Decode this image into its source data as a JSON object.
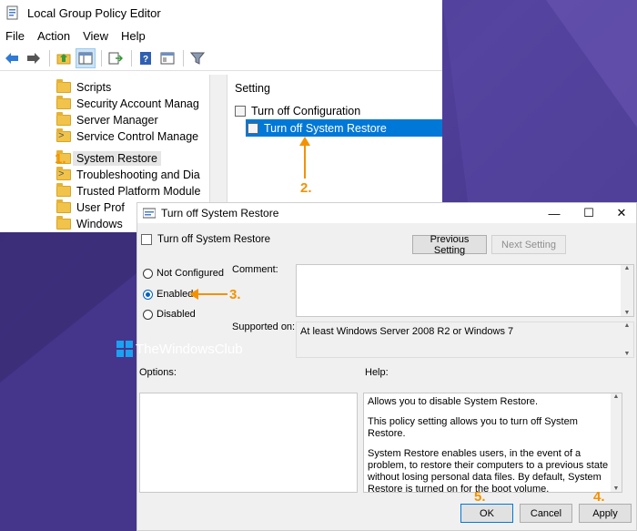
{
  "gpe": {
    "title": "Local Group Policy Editor",
    "menu": [
      "File",
      "Action",
      "View",
      "Help"
    ],
    "tree": [
      {
        "label": "Scripts",
        "expand": ""
      },
      {
        "label": "Security Account Manag",
        "expand": ""
      },
      {
        "label": "Server Manager",
        "expand": ""
      },
      {
        "label": "Service Control Manage",
        "expand": ">"
      },
      {
        "label": "System Restore",
        "expand": ""
      },
      {
        "label": "Troubleshooting and Dia",
        "expand": ">"
      },
      {
        "label": "Trusted Platform Module",
        "expand": ""
      },
      {
        "label": "User Prof",
        "expand": ""
      },
      {
        "label": "Windows",
        "expand": ""
      }
    ],
    "pane_header": "Setting",
    "settings": [
      "Turn off Configuration",
      "Turn off System Restore"
    ]
  },
  "markers": {
    "m1": "1.",
    "m2": "2.",
    "m3": "3.",
    "m4": "4.",
    "m5": "5."
  },
  "dialog": {
    "title": "Turn off System Restore",
    "policy_name": "Turn off System Restore",
    "prev_label": "Previous Setting",
    "next_label": "Next Setting",
    "radio_not_configured": "Not Configured",
    "radio_enabled": "Enabled",
    "radio_disabled": "Disabled",
    "comment_label": "Comment:",
    "supported_label": "Supported on:",
    "supported_value": "At least Windows Server 2008 R2 or Windows 7",
    "options_label": "Options:",
    "help_label": "Help:",
    "help_p1": "Allows you to disable System Restore.",
    "help_p2": "This policy setting allows you to turn off System Restore.",
    "help_p3": "System Restore enables users, in the event of a problem, to restore their computers to a previous state without losing personal data files. By default, System Restore is turned on for the boot volume.",
    "ok_label": "OK",
    "cancel_label": "Cancel",
    "apply_label": "Apply",
    "window_controls": {
      "minimize": "—",
      "maximize": "☐",
      "close": "✕"
    }
  },
  "watermark": "TheWindowsClub",
  "colors": {
    "accent": "#0078d7",
    "marker": "#f39200",
    "background": "#4a3a8c"
  }
}
